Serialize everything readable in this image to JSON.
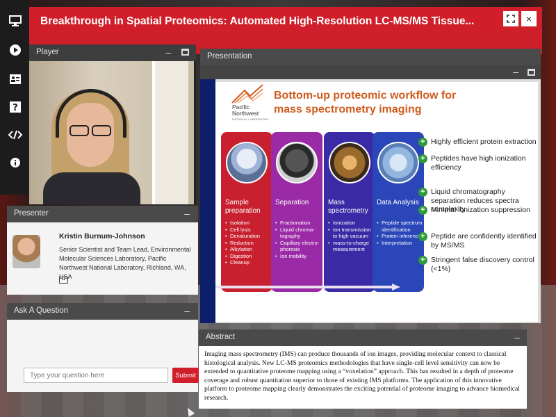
{
  "window": {
    "title": "Breakthrough in Spatial Proteomics: Automated High-Resolution LC-MS/MS Tissue...",
    "fullscreen_icon": "expand-arrows-icon",
    "close_label": "×"
  },
  "nav": [
    "screen-icon",
    "play-icon",
    "contact-card-icon",
    "help-icon",
    "code-icon",
    "info-icon"
  ],
  "player": {
    "header": "Player"
  },
  "presenter": {
    "header": "Presenter",
    "name": "Kristin Burnum-Johnson",
    "role": "Senior Scientist and Team Lead, Environmental Molecular Sciences Laboratory, Pacific Northwest National Laboratory, Richland, WA, USA"
  },
  "question": {
    "header": "Ask A Question",
    "placeholder": "Type your question here",
    "submit_label": "Submit"
  },
  "presentation": {
    "header": "Presentation",
    "slide": {
      "logo_line1": "Pacific",
      "logo_line2": "Northwest",
      "logo_line3": "NATIONAL LABORATORY",
      "title": "Bottom-up proteomic workflow for mass spectrometry imaging",
      "columns": [
        {
          "title": "Sample preparation",
          "color": "#c8202e",
          "items": [
            "Isolation",
            "Cell lysis",
            "Denaturation",
            "Reduction",
            "Alkylation",
            "Digestion",
            "Cleanup"
          ]
        },
        {
          "title": "Separation",
          "color": "#9b2aa6",
          "items": [
            "Fractionation",
            "Liquid chroma-tography",
            "Capillary electro-phoresis",
            "Ion mobility"
          ]
        },
        {
          "title": "Mass spectrometry",
          "color": "#3a2aa6",
          "items": [
            "Ionization",
            "Ion transmission to high vacuum",
            "mass-to-charge measurement"
          ]
        },
        {
          "title": "Data Analysis",
          "color": "#2a46b8",
          "items": [
            "Peptide spectrum identification",
            "Protein inference",
            "Interpretation"
          ]
        }
      ],
      "bullets": [
        "Highly efficient protein extraction",
        "Peptides have high ionization efficiency",
        "Liquid chromatography separation reduces spectra complexity",
        "Minimal ionization suppression",
        "Peptide are confidently identified by MS/MS",
        "Stringent false discovery control (<1%)"
      ]
    }
  },
  "abstract": {
    "header": "Abstract",
    "body": "Imaging mass spectrometry (IMS) can produce thousands of ion images, providing molecular context to classical histological analysis. New LC-MS proteomics methodologies that have single-cell level sensitivity can now be extended to quantitative proteome mapping using a “voxelation” approach. This has resulted in a depth of proteome coverage and robust quantitation superior to those of existing IMS platforms. The application of this innovative platform to proteome mapping clearly demonstrates the exciting potential of proteome imaging to advance biomedical research."
  }
}
